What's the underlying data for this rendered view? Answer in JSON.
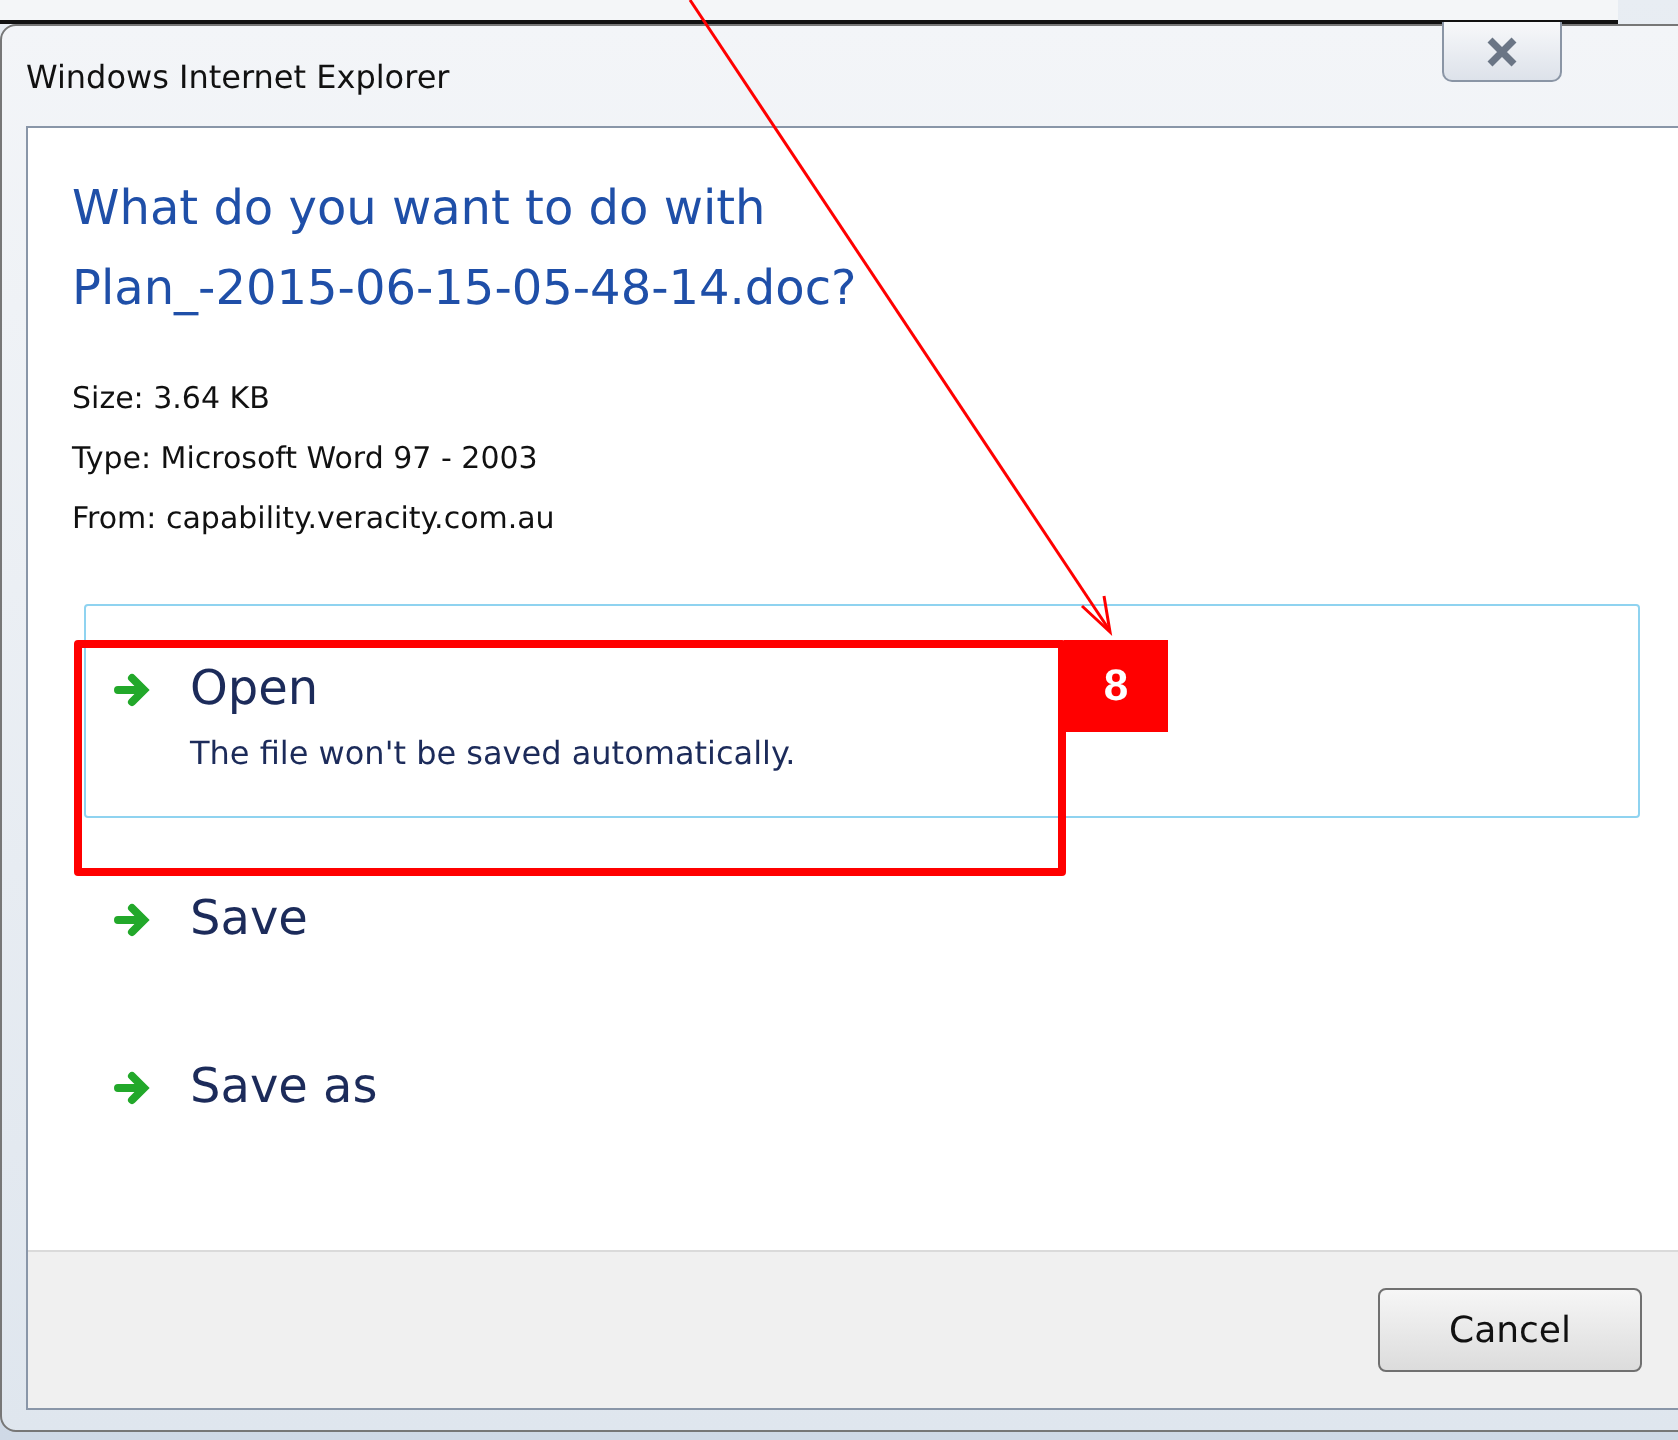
{
  "window": {
    "title": "Windows Internet Explorer"
  },
  "heading": "What do you want to do with Plan_-2015-06-15-05-48-14.doc?",
  "details": [
    "Size: 3.64 KB",
    "Type: Microsoft Word 97 - 2003",
    "From: capability.veracity.com.au"
  ],
  "options": [
    {
      "label": "Open",
      "description": "The file won't be saved automatically.",
      "selected": true
    },
    {
      "label": "Save",
      "selected": false
    },
    {
      "label": "Save as",
      "selected": false
    }
  ],
  "buttons": [
    "Cancel"
  ],
  "annotation": {
    "badge": "8"
  }
}
